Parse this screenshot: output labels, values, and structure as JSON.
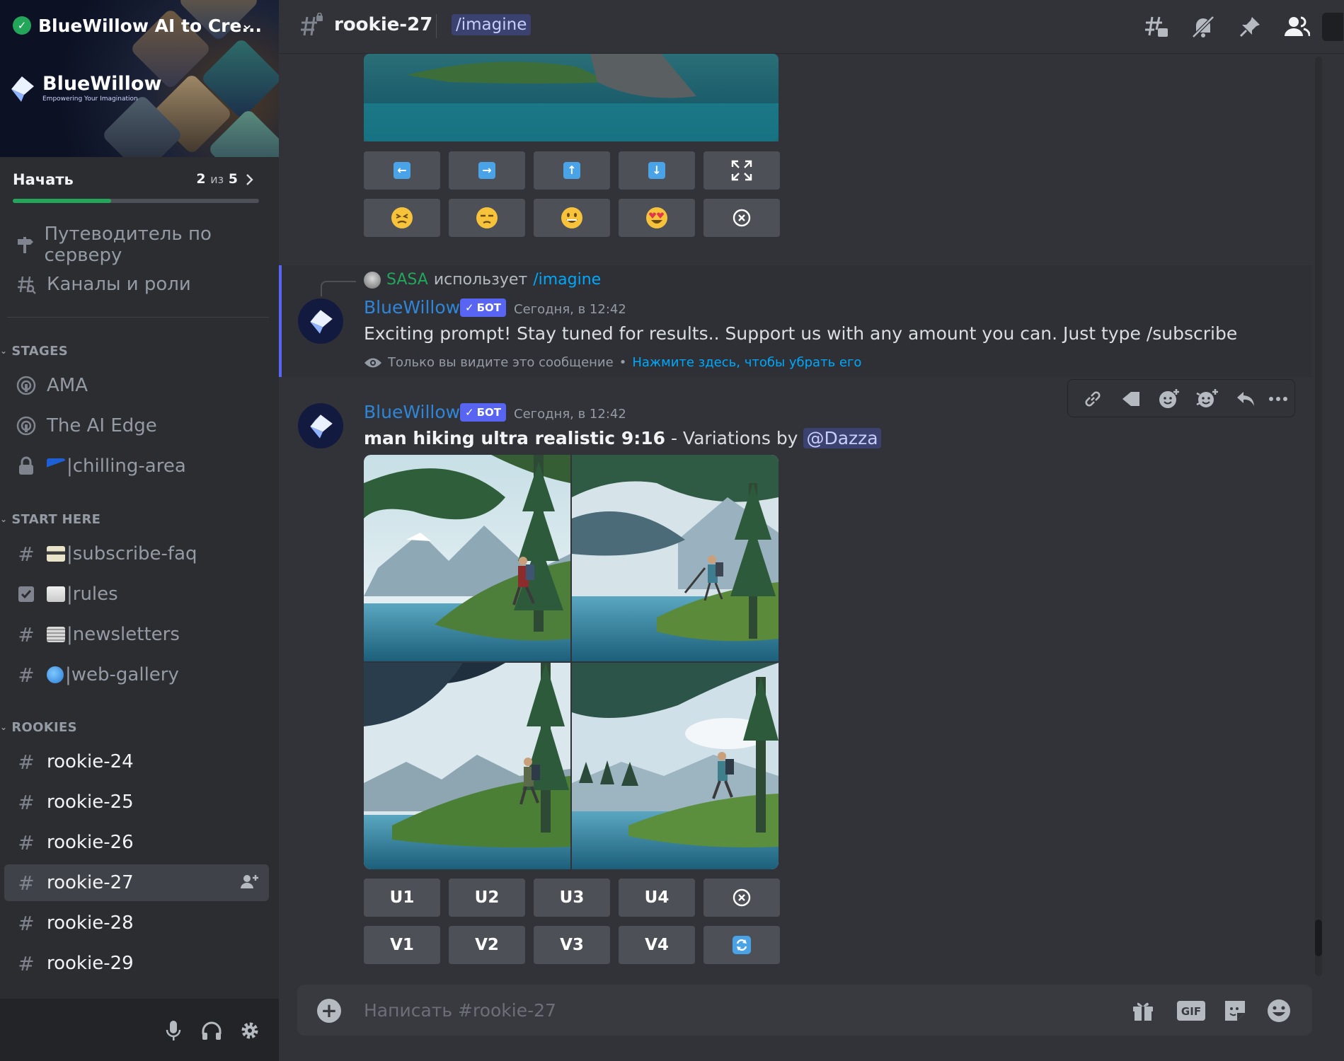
{
  "server": {
    "name": "BlueWillow AI to Cre...",
    "brand_name": "BlueWillow",
    "brand_tagline": "Empowering Your Imagination"
  },
  "onboarding": {
    "title": "Начать",
    "count": "2",
    "of_label": "из",
    "total": "5",
    "progress_fraction": 0.4
  },
  "sidebar": {
    "top_items": [
      {
        "label": "Путеводитель по серверу",
        "icon": "signpost-icon"
      },
      {
        "label": "Каналы и роли",
        "icon": "channel-browse-icon"
      }
    ],
    "categories": {
      "stages": "STAGES",
      "start_here": "START HERE",
      "rookies": "ROOKIES"
    },
    "stages": [
      {
        "label": "AMA",
        "icon": "stage-icon"
      },
      {
        "label": "The AI Edge",
        "icon": "stage-icon"
      },
      {
        "label": "|chilling-area",
        "icon": "lock-icon"
      }
    ],
    "start_here": [
      {
        "label": "|subscribe-faq",
        "icon": "hash-icon"
      },
      {
        "label": "|rules",
        "icon": "rules-icon"
      },
      {
        "label": "|newsletters",
        "icon": "hash-icon"
      },
      {
        "label": "|web-gallery",
        "icon": "hash-icon"
      }
    ],
    "rookies": [
      {
        "label": "rookie-24"
      },
      {
        "label": "rookie-25"
      },
      {
        "label": "rookie-26"
      },
      {
        "label": "rookie-27",
        "active": true
      },
      {
        "label": "rookie-28"
      },
      {
        "label": "rookie-29"
      }
    ]
  },
  "header": {
    "channel": "rookie-27",
    "topic": "/imagine"
  },
  "top_message": {
    "nav_buttons": [
      "arrow-left",
      "arrow-right",
      "arrow-up",
      "arrow-down",
      "expand"
    ],
    "reaction_buttons": [
      "persevere",
      "unamused",
      "grinning",
      "heart-eyes",
      "cancel"
    ]
  },
  "ephemeral": {
    "reply_user": "SASA",
    "reply_uses": "использует",
    "reply_command": "/imagine",
    "author": "BlueWillow",
    "bot_tag": "БОТ",
    "timestamp": "Сегодня, в 12:42",
    "text": "Exciting prompt! Stay tuned for results.. Support us with any amount you can. Just type /subscribe",
    "note": "Только вы видите это сообщение",
    "note_sep": "•",
    "dismiss": "Нажмите здесь, чтобы убрать его"
  },
  "result": {
    "author": "BlueWillow",
    "bot_tag": "БОТ",
    "timestamp": "Сегодня, в 12:42",
    "prompt": "man hiking ultra realistic 9:16",
    "suffix": " - Variations by",
    "mention": "@Dazza",
    "upscale": [
      "U1",
      "U2",
      "U3",
      "U4"
    ],
    "variation": [
      "V1",
      "V2",
      "V3",
      "V4"
    ]
  },
  "composer": {
    "placeholder": "Написать #rookie-27"
  },
  "colors": {
    "accent": "#5865f2",
    "link": "#00a8fc",
    "green": "#23a55a",
    "username": "#2f86d8"
  }
}
